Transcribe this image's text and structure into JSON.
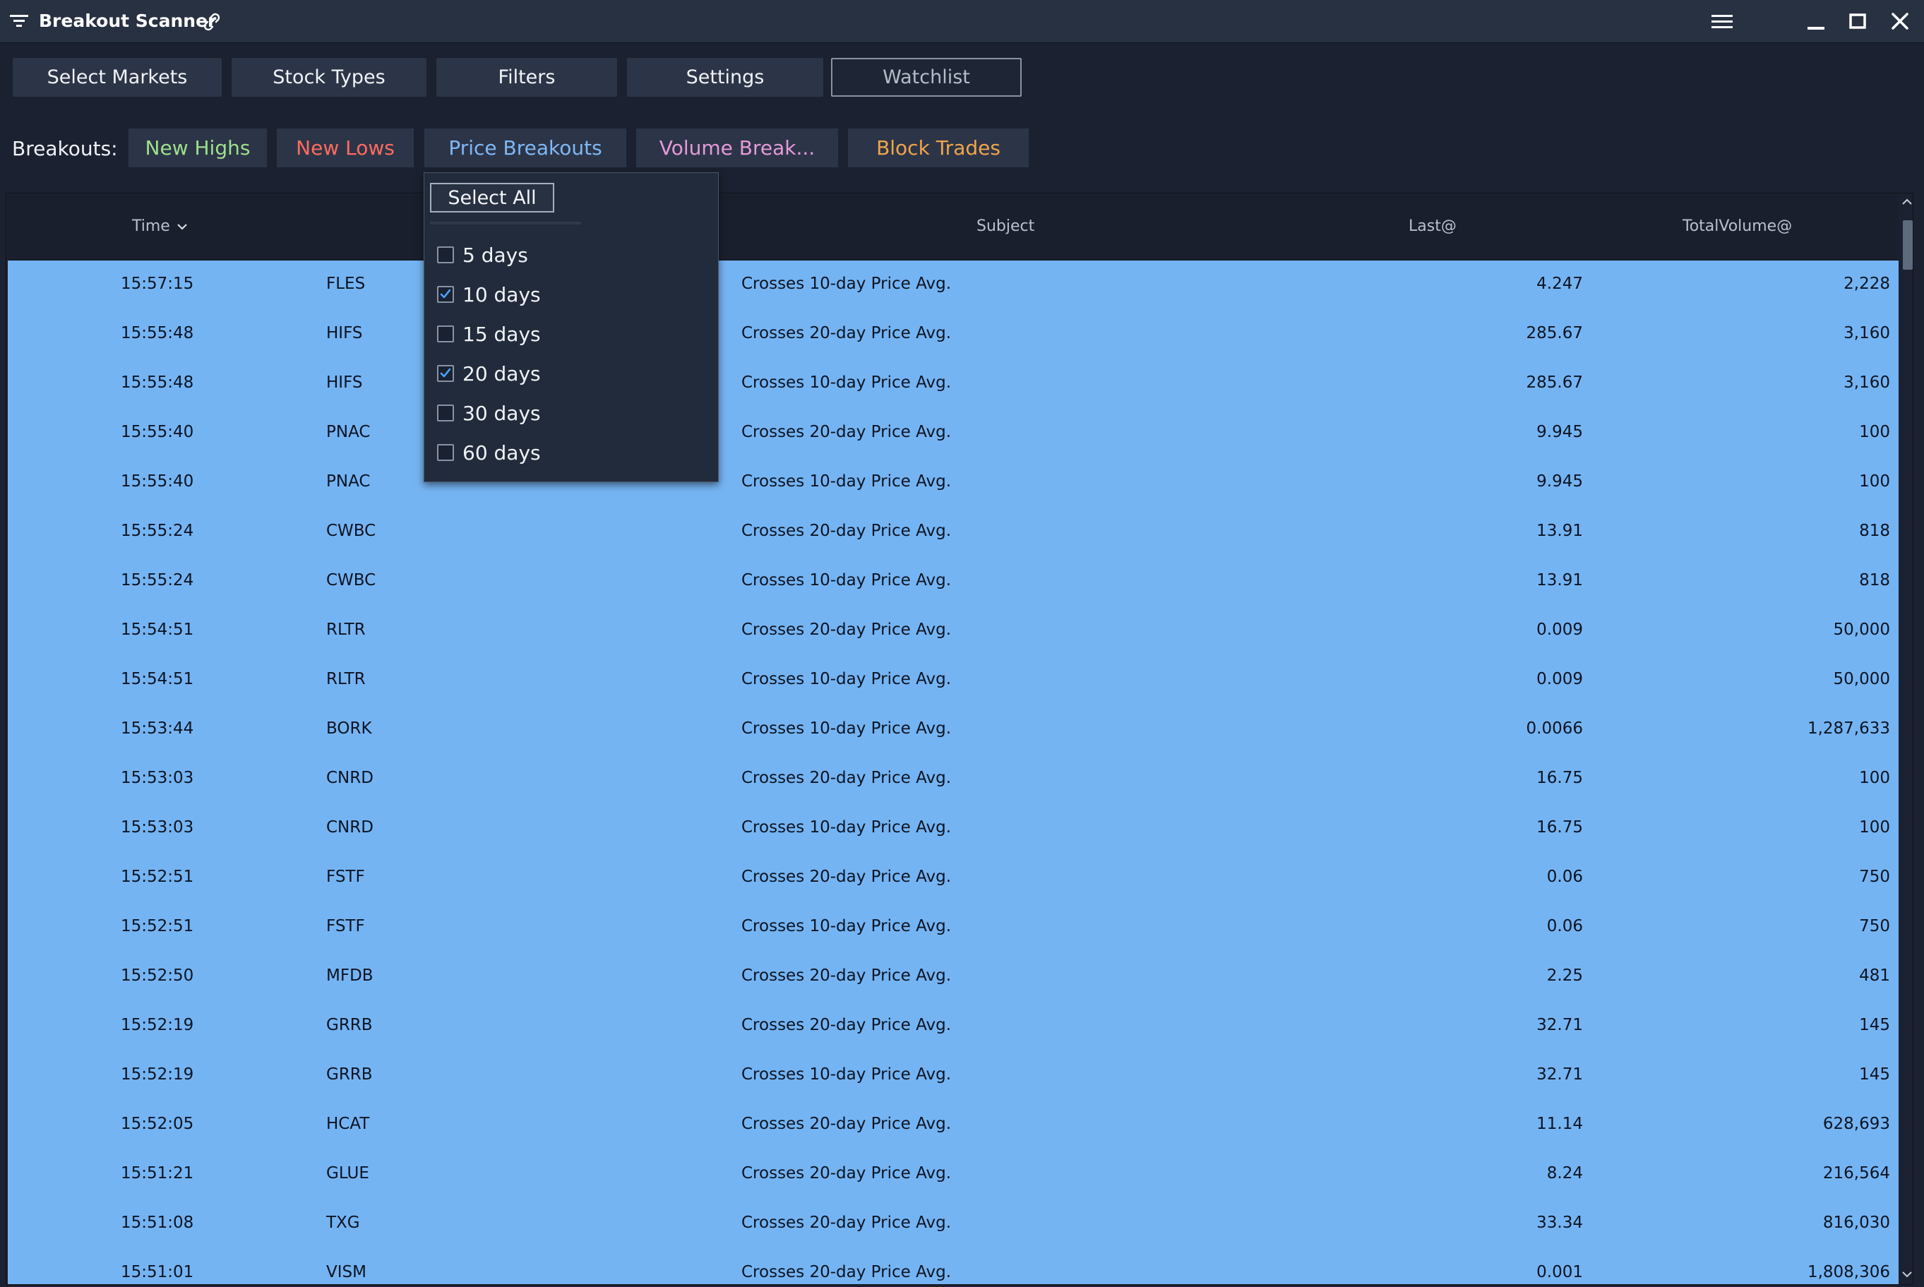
{
  "window": {
    "title": "Breakout Scanner"
  },
  "toolbar": {
    "buttons": [
      "Select Markets",
      "Stock Types",
      "Filters",
      "Settings",
      "Watchlist"
    ]
  },
  "breakouts": {
    "label": "Breakouts:",
    "tabs": [
      {
        "label": "New Highs",
        "color": "#9fe08a"
      },
      {
        "label": "New Lows",
        "color": "#ff6b5e"
      },
      {
        "label": "Price Breakouts",
        "color": "#7fb8f5"
      },
      {
        "label": "Volume Break...",
        "color": "#e59ad8"
      },
      {
        "label": "Block Trades",
        "color": "#f0a54a"
      }
    ]
  },
  "dropdown": {
    "select_all": "Select All",
    "options": [
      {
        "label": "5 days",
        "checked": false
      },
      {
        "label": "10 days",
        "checked": true
      },
      {
        "label": "15 days",
        "checked": false
      },
      {
        "label": "20 days",
        "checked": true
      },
      {
        "label": "30 days",
        "checked": false
      },
      {
        "label": "60 days",
        "checked": false
      }
    ]
  },
  "table": {
    "columns": {
      "time": "Time",
      "subject": "Subject",
      "last": "Last@",
      "volume": "TotalVolume@"
    },
    "rows": [
      {
        "time": "15:57:15",
        "symbol": "FLES",
        "subject": "Crosses 10-day Price Avg.",
        "last": "4.247",
        "volume": "2,228"
      },
      {
        "time": "15:55:48",
        "symbol": "HIFS",
        "subject": "Crosses 20-day Price Avg.",
        "last": "285.67",
        "volume": "3,160"
      },
      {
        "time": "15:55:48",
        "symbol": "HIFS",
        "subject": "Crosses 10-day Price Avg.",
        "last": "285.67",
        "volume": "3,160"
      },
      {
        "time": "15:55:40",
        "symbol": "PNAC",
        "subject": "Crosses 20-day Price Avg.",
        "last": "9.945",
        "volume": "100"
      },
      {
        "time": "15:55:40",
        "symbol": "PNAC",
        "subject": "Crosses 10-day Price Avg.",
        "last": "9.945",
        "volume": "100"
      },
      {
        "time": "15:55:24",
        "symbol": "CWBC",
        "subject": "Crosses 20-day Price Avg.",
        "last": "13.91",
        "volume": "818"
      },
      {
        "time": "15:55:24",
        "symbol": "CWBC",
        "subject": "Crosses 10-day Price Avg.",
        "last": "13.91",
        "volume": "818"
      },
      {
        "time": "15:54:51",
        "symbol": "RLTR",
        "subject": "Crosses 20-day Price Avg.",
        "last": "0.009",
        "volume": "50,000"
      },
      {
        "time": "15:54:51",
        "symbol": "RLTR",
        "subject": "Crosses 10-day Price Avg.",
        "last": "0.009",
        "volume": "50,000"
      },
      {
        "time": "15:53:44",
        "symbol": "BORK",
        "subject": "Crosses 10-day Price Avg.",
        "last": "0.0066",
        "volume": "1,287,633"
      },
      {
        "time": "15:53:03",
        "symbol": "CNRD",
        "subject": "Crosses 20-day Price Avg.",
        "last": "16.75",
        "volume": "100"
      },
      {
        "time": "15:53:03",
        "symbol": "CNRD",
        "subject": "Crosses 10-day Price Avg.",
        "last": "16.75",
        "volume": "100"
      },
      {
        "time": "15:52:51",
        "symbol": "FSTF",
        "subject": "Crosses 20-day Price Avg.",
        "last": "0.06",
        "volume": "750"
      },
      {
        "time": "15:52:51",
        "symbol": "FSTF",
        "subject": "Crosses 10-day Price Avg.",
        "last": "0.06",
        "volume": "750"
      },
      {
        "time": "15:52:50",
        "symbol": "MFDB",
        "subject": "Crosses 20-day Price Avg.",
        "last": "2.25",
        "volume": "481"
      },
      {
        "time": "15:52:19",
        "symbol": "GRRB",
        "subject": "Crosses 20-day Price Avg.",
        "last": "32.71",
        "volume": "145"
      },
      {
        "time": "15:52:19",
        "symbol": "GRRB",
        "subject": "Crosses 10-day Price Avg.",
        "last": "32.71",
        "volume": "145"
      },
      {
        "time": "15:52:05",
        "symbol": "HCAT",
        "subject": "Crosses 20-day Price Avg.",
        "last": "11.14",
        "volume": "628,693"
      },
      {
        "time": "15:51:21",
        "symbol": "GLUE",
        "subject": "Crosses 20-day Price Avg.",
        "last": "8.24",
        "volume": "216,564"
      },
      {
        "time": "15:51:08",
        "symbol": "TXG",
        "subject": "Crosses 20-day Price Avg.",
        "last": "33.34",
        "volume": "816,030"
      },
      {
        "time": "15:51:01",
        "symbol": "VISM",
        "subject": "Crosses 20-day Price Avg.",
        "last": "0.001",
        "volume": "1,808,306"
      }
    ]
  },
  "colors": {
    "row_highlight": "#75b4f3",
    "background": "#1b2130",
    "titlebar": "#283142",
    "check": "#4aa3ff"
  }
}
